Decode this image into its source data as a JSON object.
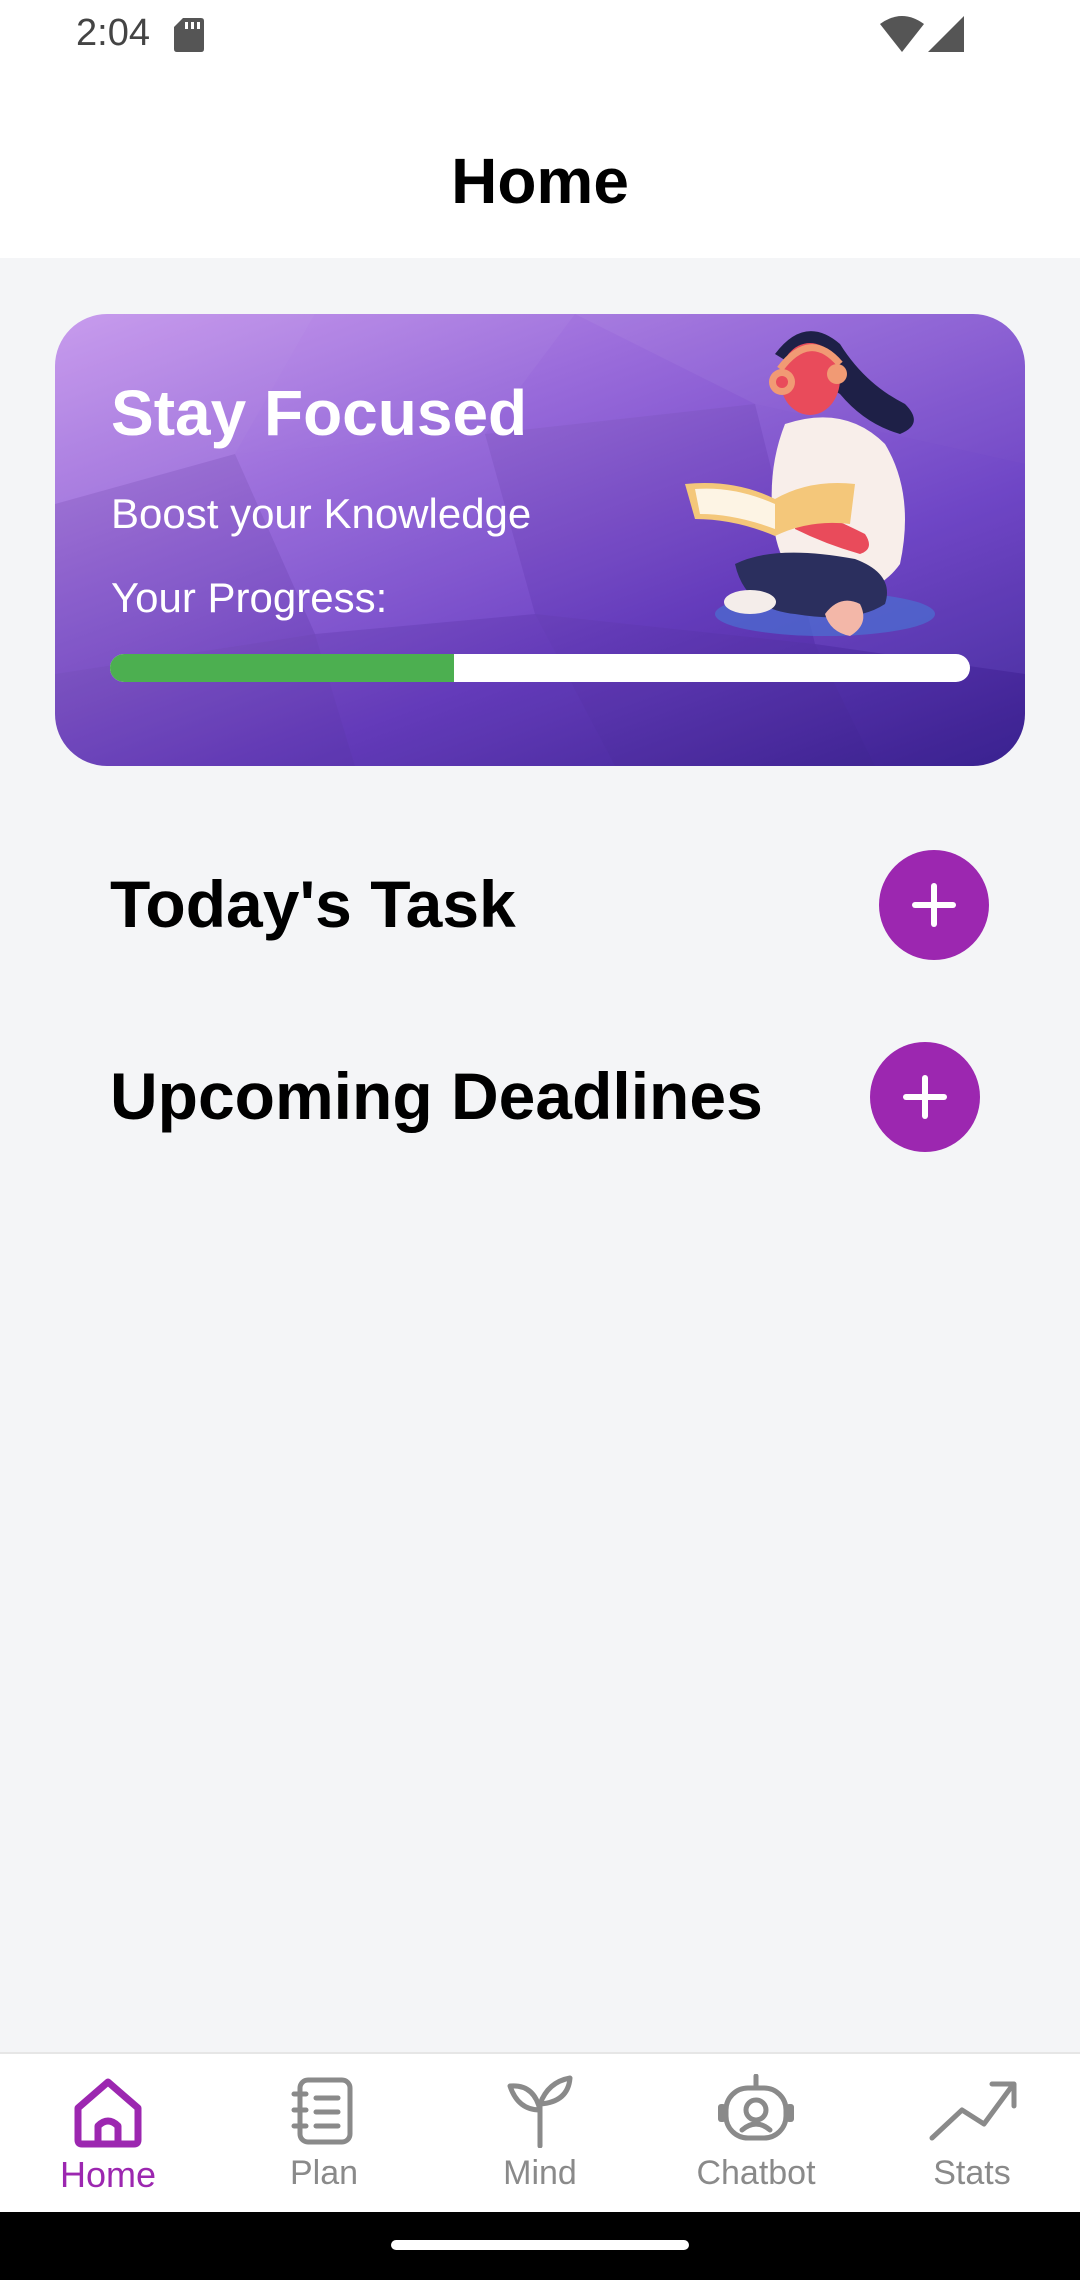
{
  "status_bar": {
    "time": "2:04",
    "icons": [
      "sd-card-icon",
      "wifi-icon",
      "signal-icon"
    ]
  },
  "header": {
    "title": "Home"
  },
  "banner": {
    "heading": "Stay Focused",
    "subheading": "Boost your Knowledge",
    "progress_label": "Your Progress:",
    "progress_fraction": 0.4,
    "gradient_colors": [
      "#C596EC",
      "#9A6CDB",
      "#6A3FC4",
      "#3D2397"
    ],
    "progress_fill_color": "#4CAF50",
    "illustration": "person-reading-with-headphones"
  },
  "sections": {
    "today_task": {
      "title": "Today's Task",
      "add_icon": "plus-icon"
    },
    "upcoming_deadlines": {
      "title": "Upcoming Deadlines",
      "add_icon": "plus-icon"
    }
  },
  "bottom_nav": {
    "items": [
      {
        "label": "Home",
        "icon": "home-icon",
        "active": true
      },
      {
        "label": "Plan",
        "icon": "notebook-icon",
        "active": false
      },
      {
        "label": "Mind",
        "icon": "sprout-icon",
        "active": false
      },
      {
        "label": "Chatbot",
        "icon": "robot-icon",
        "active": false
      },
      {
        "label": "Stats",
        "icon": "trending-up-icon",
        "active": false
      }
    ]
  },
  "colors": {
    "accent": "#9C27B0",
    "inactive": "#8A8A8A",
    "background": "#F4F5F7"
  }
}
